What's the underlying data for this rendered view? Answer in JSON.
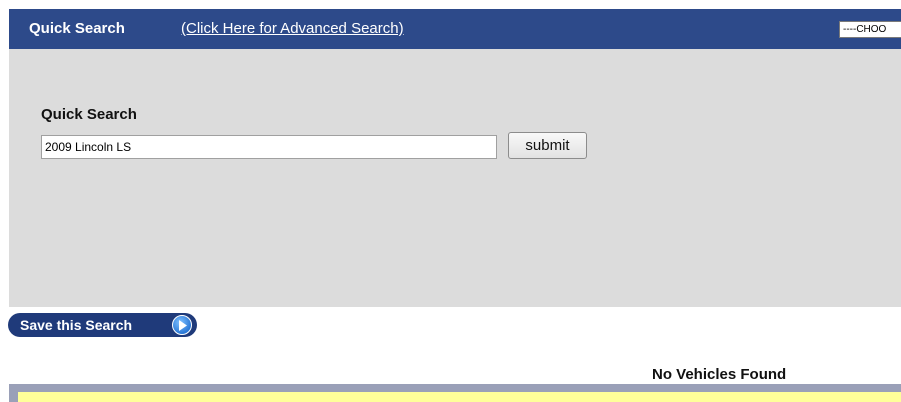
{
  "header": {
    "title": "Quick Search",
    "advanced_link": "(Click Here for Advanced Search)",
    "choose_select": "----CHOO"
  },
  "search": {
    "label": "Quick Search",
    "value": "2009 Lincoln LS",
    "submit_label": "submit"
  },
  "save_search": {
    "label": "Save this Search",
    "icon": "play-arrow-icon"
  },
  "results": {
    "message": "No Vehicles Found"
  },
  "colors": {
    "header_bg": "#2d4a8a",
    "panel_bg": "#dcdcdc",
    "results_bg": "#ffff99",
    "results_border": "#9aa0b8"
  }
}
